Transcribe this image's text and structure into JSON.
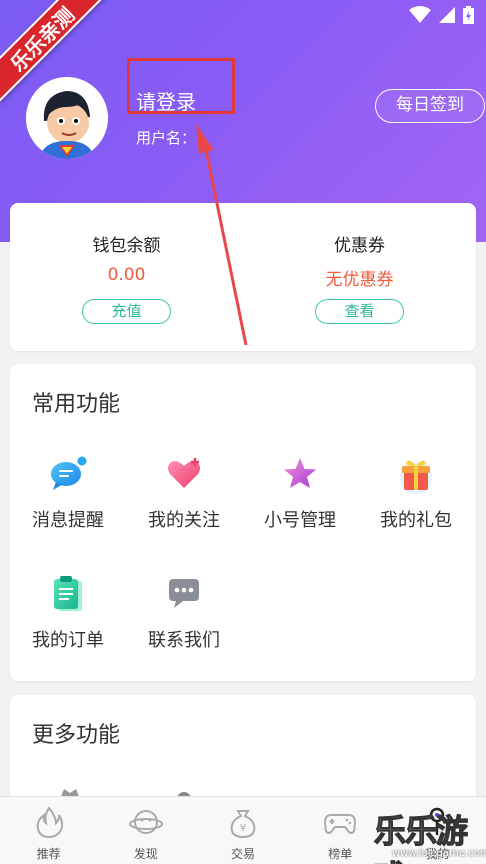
{
  "ribbon": "乐乐亲测",
  "header": {
    "login": "请登录",
    "username_label": "用户名：",
    "checkin": "每日签到"
  },
  "wallet": {
    "balance_label": "钱包余额",
    "balance_value": "0.00",
    "recharge": "充值",
    "coupon_label": "优惠券",
    "coupon_value": "无优惠券",
    "view": "查看"
  },
  "common": {
    "title": "常用功能",
    "items": [
      {
        "label": "消息提醒",
        "icon": "message-icon"
      },
      {
        "label": "我的关注",
        "icon": "heart-icon"
      },
      {
        "label": "小号管理",
        "icon": "star-icon"
      },
      {
        "label": "我的礼包",
        "icon": "gift-icon"
      },
      {
        "label": "我的订单",
        "icon": "order-icon"
      },
      {
        "label": "联系我们",
        "icon": "chat-icon"
      }
    ]
  },
  "more": {
    "title": "更多功能"
  },
  "tabs": [
    {
      "label": "推荐",
      "icon": "flame-icon"
    },
    {
      "label": "发现",
      "icon": "planet-icon"
    },
    {
      "label": "交易",
      "icon": "money-bag-icon"
    },
    {
      "label": "榜单",
      "icon": "gamepad-icon"
    },
    {
      "label": "我的",
      "icon": "user-icon"
    }
  ],
  "watermark": {
    "text": "乐乐游戏",
    "url": "www.lelegame.com"
  },
  "colors": {
    "accent": "#8b5cf6",
    "price": "#f05a3a",
    "teal": "#2bb79b",
    "ribbon": "#d9262c"
  }
}
